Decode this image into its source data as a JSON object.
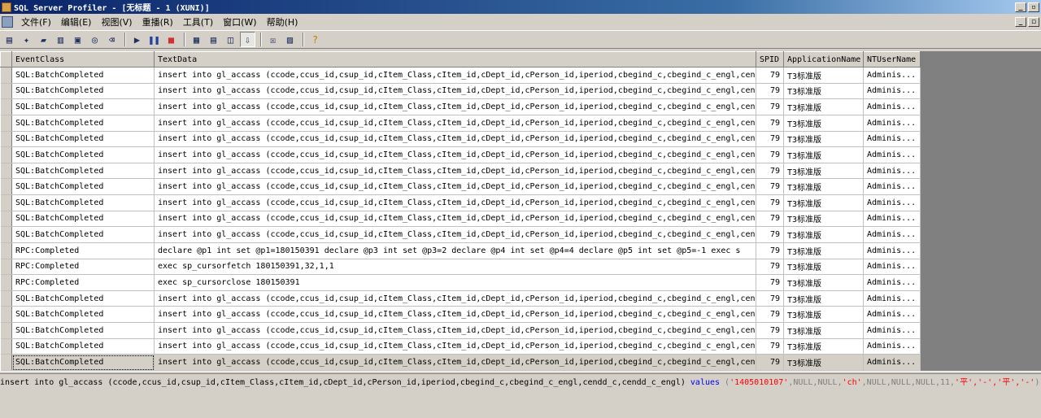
{
  "window": {
    "title": "SQL Server Profiler - [无标题 - 1 (XUNI)]",
    "min_label": "_",
    "restore_label": "▫",
    "close_label": "×"
  },
  "menu": {
    "items": [
      "文件(F)",
      "编辑(E)",
      "视图(V)",
      "重播(R)",
      "工具(T)",
      "窗口(W)",
      "帮助(H)"
    ]
  },
  "toolbar": {
    "icons": [
      "new-trace-icon",
      "new-file-icon",
      "open-icon",
      "open-table-icon",
      "properties-icon",
      "find-icon",
      "clear-icon",
      "run-icon",
      "pause-icon",
      "stop-icon",
      "toggle-columns-icon",
      "aggregate-icon",
      "pane-icon",
      "autoscroll-icon",
      "template-icon",
      "perf-icon",
      "help-icon"
    ]
  },
  "grid": {
    "columns": [
      "EventClass",
      "TextData",
      "SPID",
      "ApplicationName",
      "NTUserName"
    ],
    "rows": [
      [
        "SQL:BatchCompleted",
        "insert into gl_accass (ccode,ccus_id,csup_id,cItem_Class,cItem_id,cDept_id,cPerson_id,iperiod,cbegind_c,cbegind_c_engl,cendd_c,",
        "79",
        "T3标准版",
        "Adminis..."
      ],
      [
        "SQL:BatchCompleted",
        "insert into gl_accass (ccode,ccus_id,csup_id,cItem_Class,cItem_id,cDept_id,cPerson_id,iperiod,cbegind_c,cbegind_c_engl,cendd_c,",
        "79",
        "T3标准版",
        "Adminis..."
      ],
      [
        "SQL:BatchCompleted",
        "insert into gl_accass (ccode,ccus_id,csup_id,cItem_Class,cItem_id,cDept_id,cPerson_id,iperiod,cbegind_c,cbegind_c_engl,cendd_c,",
        "79",
        "T3标准版",
        "Adminis..."
      ],
      [
        "SQL:BatchCompleted",
        "insert into gl_accass (ccode,ccus_id,csup_id,cItem_Class,cItem_id,cDept_id,cPerson_id,iperiod,cbegind_c,cbegind_c_engl,cendd_c,",
        "79",
        "T3标准版",
        "Adminis..."
      ],
      [
        "SQL:BatchCompleted",
        "insert into gl_accass (ccode,ccus_id,csup_id,cItem_Class,cItem_id,cDept_id,cPerson_id,iperiod,cbegind_c,cbegind_c_engl,cendd_c,",
        "79",
        "T3标准版",
        "Adminis..."
      ],
      [
        "SQL:BatchCompleted",
        "insert into gl_accass (ccode,ccus_id,csup_id,cItem_Class,cItem_id,cDept_id,cPerson_id,iperiod,cbegind_c,cbegind_c_engl,cendd_c,",
        "79",
        "T3标准版",
        "Adminis..."
      ],
      [
        "SQL:BatchCompleted",
        "insert into gl_accass (ccode,ccus_id,csup_id,cItem_Class,cItem_id,cDept_id,cPerson_id,iperiod,cbegind_c,cbegind_c_engl,cendd_c,",
        "79",
        "T3标准版",
        "Adminis..."
      ],
      [
        "SQL:BatchCompleted",
        "insert into gl_accass (ccode,ccus_id,csup_id,cItem_Class,cItem_id,cDept_id,cPerson_id,iperiod,cbegind_c,cbegind_c_engl,cendd_c,",
        "79",
        "T3标准版",
        "Adminis..."
      ],
      [
        "SQL:BatchCompleted",
        "insert into gl_accass (ccode,ccus_id,csup_id,cItem_Class,cItem_id,cDept_id,cPerson_id,iperiod,cbegind_c,cbegind_c_engl,cendd_c,",
        "79",
        "T3标准版",
        "Adminis..."
      ],
      [
        "SQL:BatchCompleted",
        "insert into gl_accass (ccode,ccus_id,csup_id,cItem_Class,cItem_id,cDept_id,cPerson_id,iperiod,cbegind_c,cbegind_c_engl,cendd_c,",
        "79",
        "T3标准版",
        "Adminis..."
      ],
      [
        "SQL:BatchCompleted",
        "insert into gl_accass (ccode,ccus_id,csup_id,cItem_Class,cItem_id,cDept_id,cPerson_id,iperiod,cbegind_c,cbegind_c_engl,cendd_c,",
        "79",
        "T3标准版",
        "Adminis..."
      ],
      [
        "RPC:Completed",
        "declare @p1 int  set @p1=180150391  declare @p3 int  set @p3=2  declare @p4 int  set @p4=4  declare @p5 int  set @p5=-1  exec s",
        "79",
        "T3标准版",
        "Adminis..."
      ],
      [
        "RPC:Completed",
        "exec sp_cursorfetch 180150391,32,1,1",
        "79",
        "T3标准版",
        "Adminis..."
      ],
      [
        "RPC:Completed",
        "exec sp_cursorclose 180150391",
        "79",
        "T3标准版",
        "Adminis..."
      ],
      [
        "SQL:BatchCompleted",
        "insert into gl_accass (ccode,ccus_id,csup_id,cItem_Class,cItem_id,cDept_id,cPerson_id,iperiod,cbegind_c,cbegind_c_engl,cendd_c,",
        "79",
        "T3标准版",
        "Adminis..."
      ],
      [
        "SQL:BatchCompleted",
        "insert into gl_accass (ccode,ccus_id,csup_id,cItem_Class,cItem_id,cDept_id,cPerson_id,iperiod,cbegind_c,cbegind_c_engl,cendd_c,",
        "79",
        "T3标准版",
        "Adminis..."
      ],
      [
        "SQL:BatchCompleted",
        "insert into gl_accass (ccode,ccus_id,csup_id,cItem_Class,cItem_id,cDept_id,cPerson_id,iperiod,cbegind_c,cbegind_c_engl,cendd_c,",
        "79",
        "T3标准版",
        "Adminis..."
      ],
      [
        "SQL:BatchCompleted",
        "insert into gl_accass (ccode,ccus_id,csup_id,cItem_Class,cItem_id,cDept_id,cPerson_id,iperiod,cbegind_c,cbegind_c_engl,cendd_c,",
        "79",
        "T3标准版",
        "Adminis..."
      ],
      [
        "SQL:BatchCompleted",
        "insert into gl_accass (ccode,ccus_id,csup_id,cItem_Class,cItem_id,cDept_id,cPerson_id,iperiod,cbegind_c,cbegind_c_engl,cendd_c,",
        "79",
        "T3标准版",
        "Adminis..."
      ]
    ],
    "selected_row": 18
  },
  "detail": {
    "prefix": "insert into gl_accass (ccode,ccus_id,csup_id,cItem_Class,cItem_id,cDept_id,cPerson_id,iperiod,cbegind_c,cbegind_c_engl,cendd_c,cendd_c_engl) ",
    "keyword": "values",
    "paren_open": " (",
    "str1": "'1405010107'",
    "mid": ",NULL,NULL,",
    "str2": "'ch'",
    "mid2": ",NULL,NULL,NULL,11,",
    "str3": "'平','-','平','-'",
    "paren_close": ")"
  },
  "colors": {
    "keyword": "#0000ff",
    "string": "#ff0000",
    "selected_row": "#d4d0c8",
    "titlebar": "#0a246a"
  }
}
